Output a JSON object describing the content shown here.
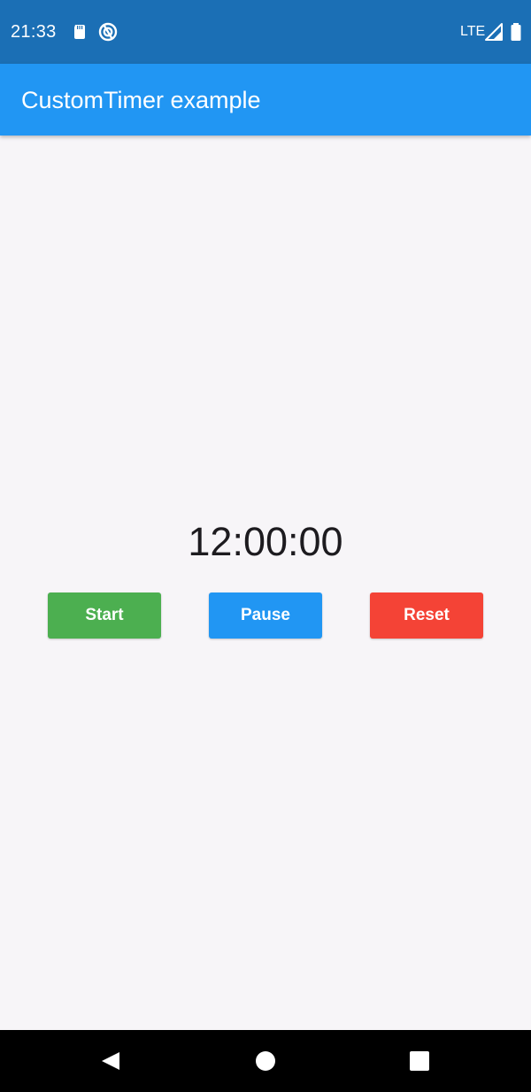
{
  "status_bar": {
    "time": "21:33",
    "network": "LTE",
    "icons": [
      "sd-card-icon",
      "sync-circle-icon",
      "signal-icon",
      "battery-icon"
    ]
  },
  "app_bar": {
    "title": "CustomTimer example"
  },
  "timer": {
    "display": "12:00:00"
  },
  "buttons": {
    "start": "Start",
    "pause": "Pause",
    "reset": "Reset"
  },
  "nav_bar": {
    "icons": [
      "back-icon",
      "home-icon",
      "recents-icon"
    ]
  },
  "colors": {
    "status_bar": "#1b6fb5",
    "app_bar": "#2196f3",
    "background": "#f7f5f8",
    "start": "#4caf50",
    "pause": "#2196f3",
    "reset": "#f44336",
    "nav_bar": "#000000"
  }
}
